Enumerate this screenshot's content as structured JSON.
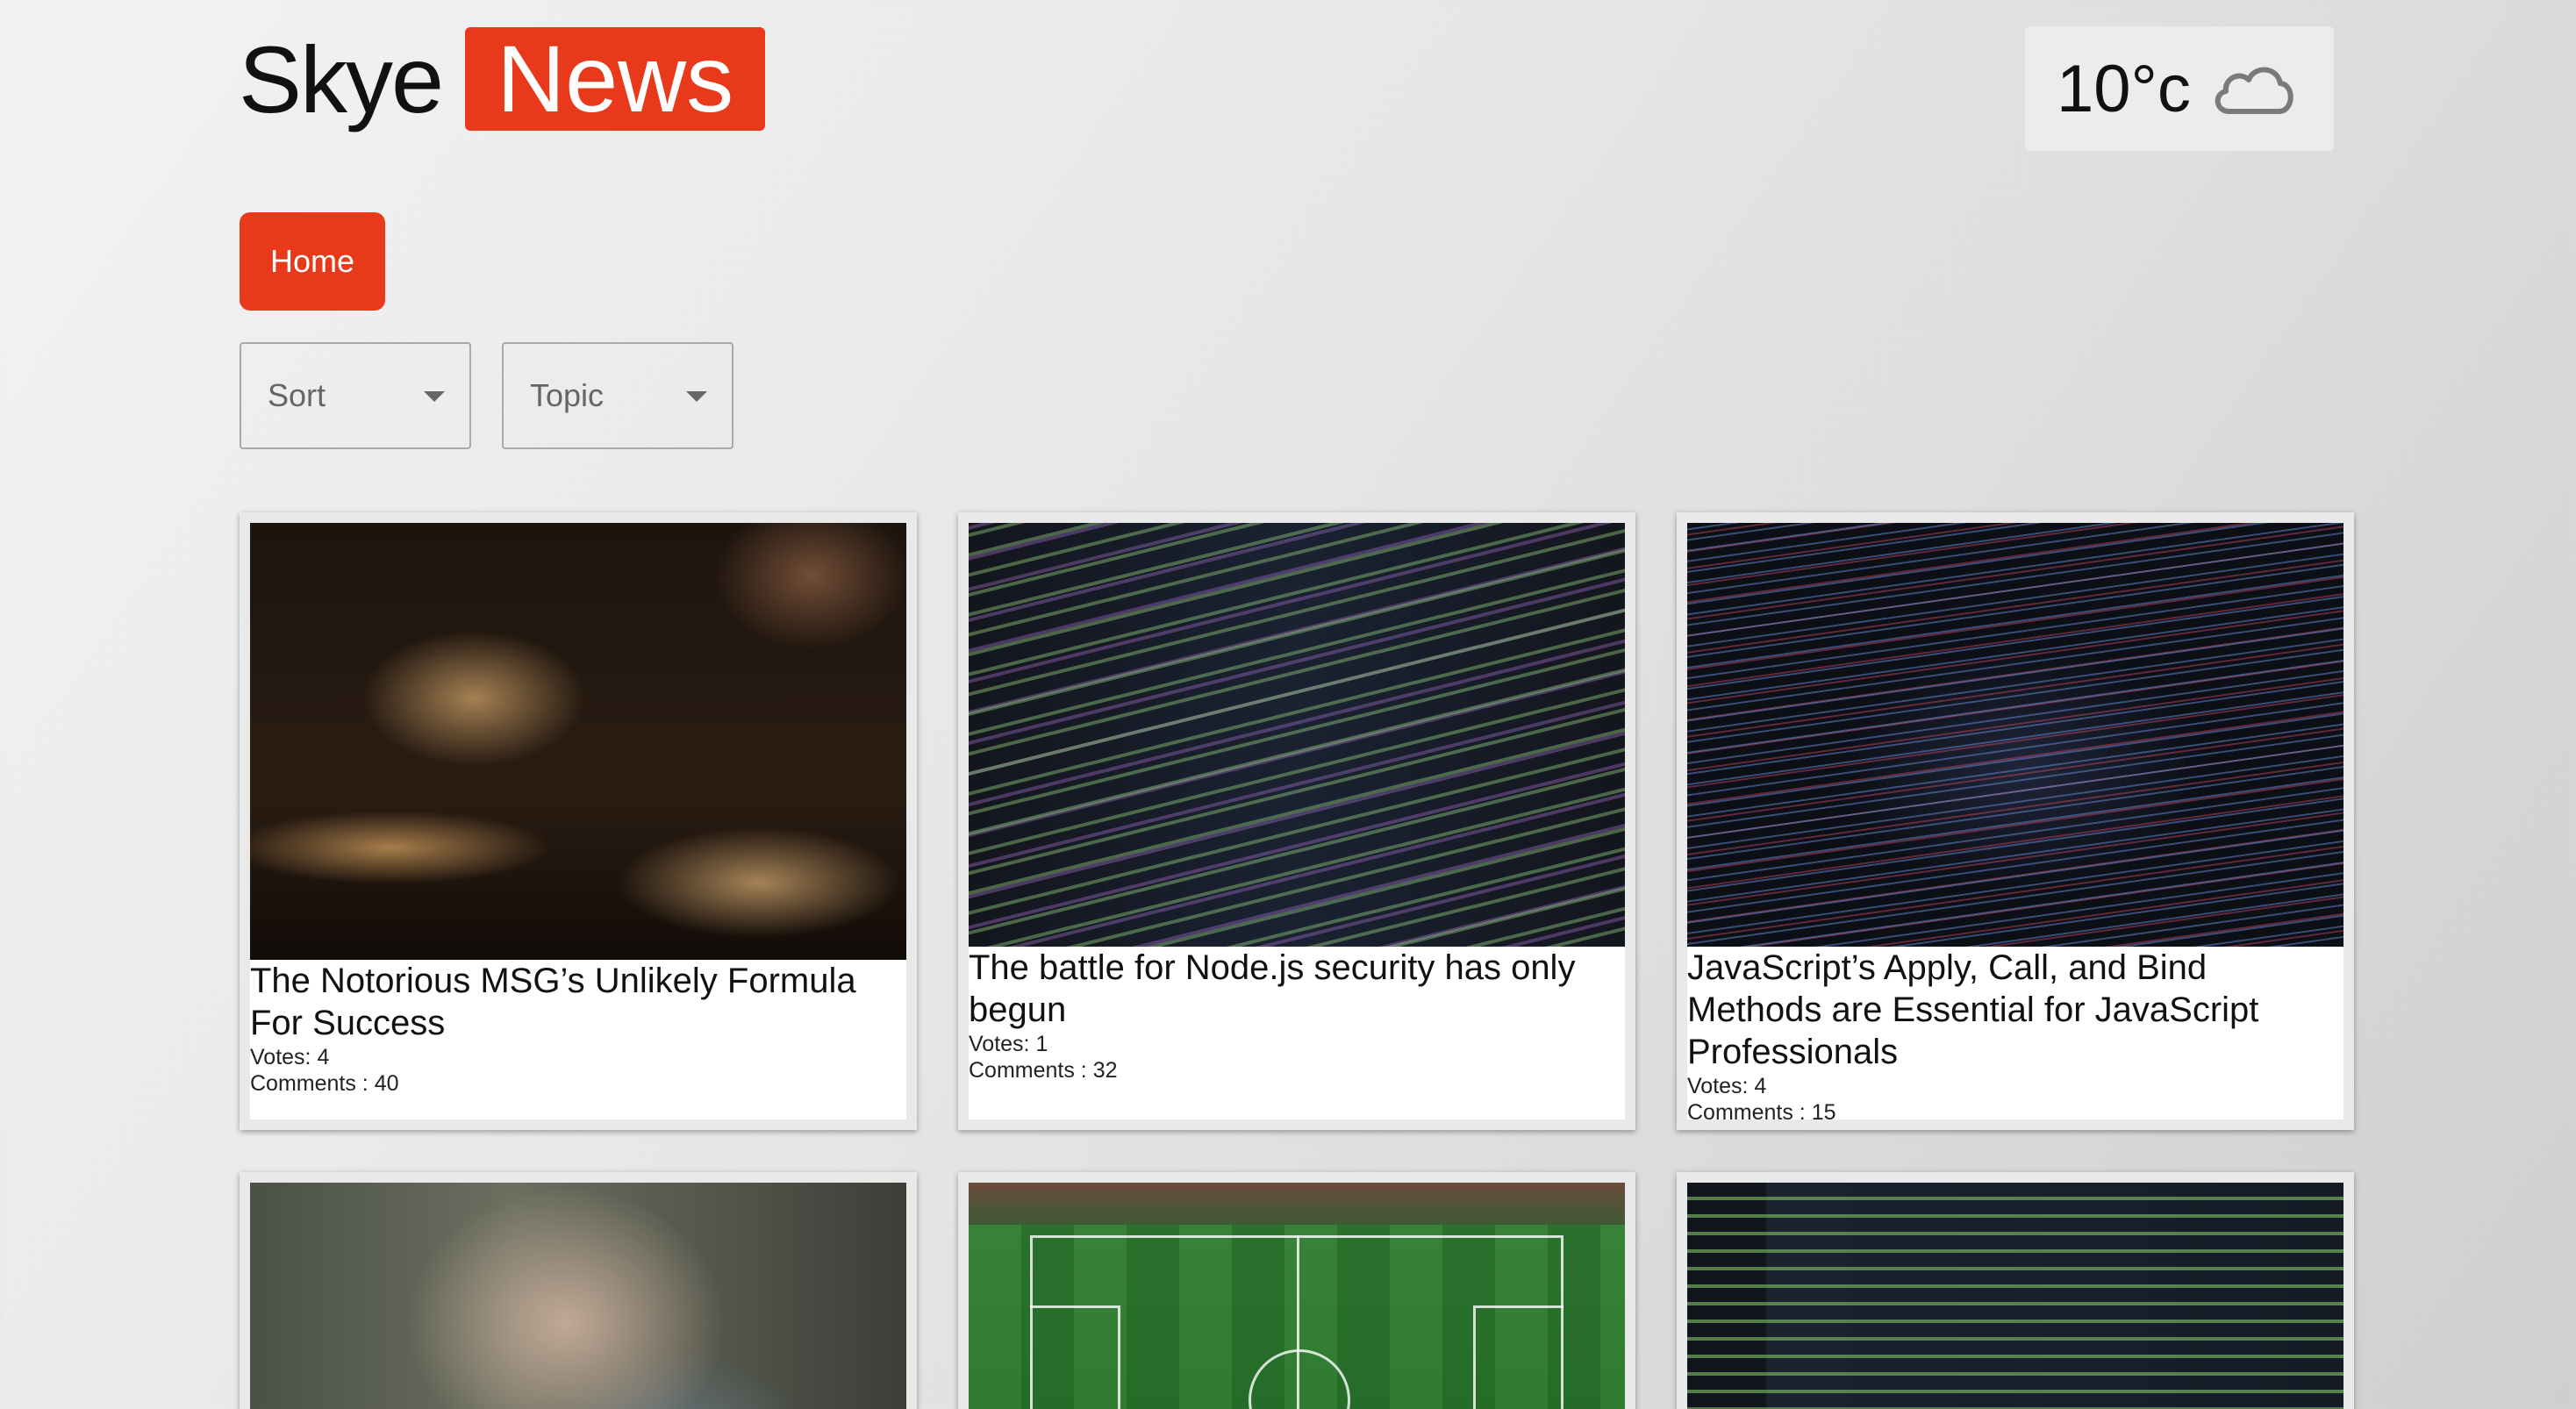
{
  "header": {
    "logo_part1": "Skye",
    "logo_part2": "News",
    "brand_color": "#e8391a"
  },
  "weather": {
    "temperature": "10°c",
    "icon": "cloud-icon"
  },
  "nav": {
    "home_label": "Home"
  },
  "filters": {
    "sort_label": "Sort",
    "topic_label": "Topic"
  },
  "articles": [
    {
      "title": "The Notorious MSG’s Unlikely Formula For Success",
      "votes": "Votes: 4",
      "comments": "Comments : 40",
      "image": "food-photo"
    },
    {
      "title": "The battle for Node.js security has only begun",
      "votes": "Votes: 1",
      "comments": "Comments : 32",
      "image": "code-screen-photo"
    },
    {
      "title": "JavaScript’s Apply, Call, and Bind Methods are Essential for JavaScript Professionals",
      "votes": "Votes: 4",
      "comments": "Comments : 15",
      "image": "code-screen-dark-photo"
    },
    {
      "image": "person-blurred-photo"
    },
    {
      "image": "football-pitch-aerial-photo"
    },
    {
      "image": "code-editor-photo"
    }
  ]
}
